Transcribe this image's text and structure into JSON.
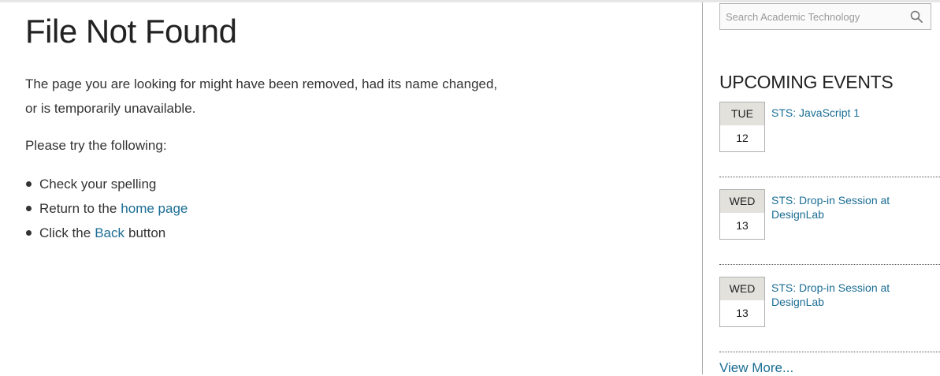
{
  "main": {
    "title": "File Not Found",
    "intro_line1": "The page you are looking for might have been removed, had its name changed,",
    "intro_line2": "or is temporarily unavailable.",
    "try_label": "Please try the following:",
    "suggestions": [
      {
        "before": "Check your spelling",
        "link": "",
        "after": ""
      },
      {
        "before": "Return to the",
        "link": "home page",
        "after": ""
      },
      {
        "before": "Click the",
        "link": "Back",
        "after": "button"
      }
    ]
  },
  "sidebar": {
    "search": {
      "placeholder": "Search Academic Technology",
      "icon": "search-icon"
    },
    "events_heading": "UPCOMING EVENTS",
    "events": [
      {
        "dow": "TUE",
        "day": "12",
        "title": "STS: JavaScript 1"
      },
      {
        "dow": "WED",
        "day": "13",
        "title": "STS: Drop-in Session at DesignLab"
      },
      {
        "dow": "WED",
        "day": "13",
        "title": "STS: Drop-in Session at DesignLab"
      }
    ],
    "view_more": "View More..."
  },
  "colors": {
    "link": "#1a6d94",
    "date_header_bg": "#e2e1dc",
    "text": "#333333"
  }
}
